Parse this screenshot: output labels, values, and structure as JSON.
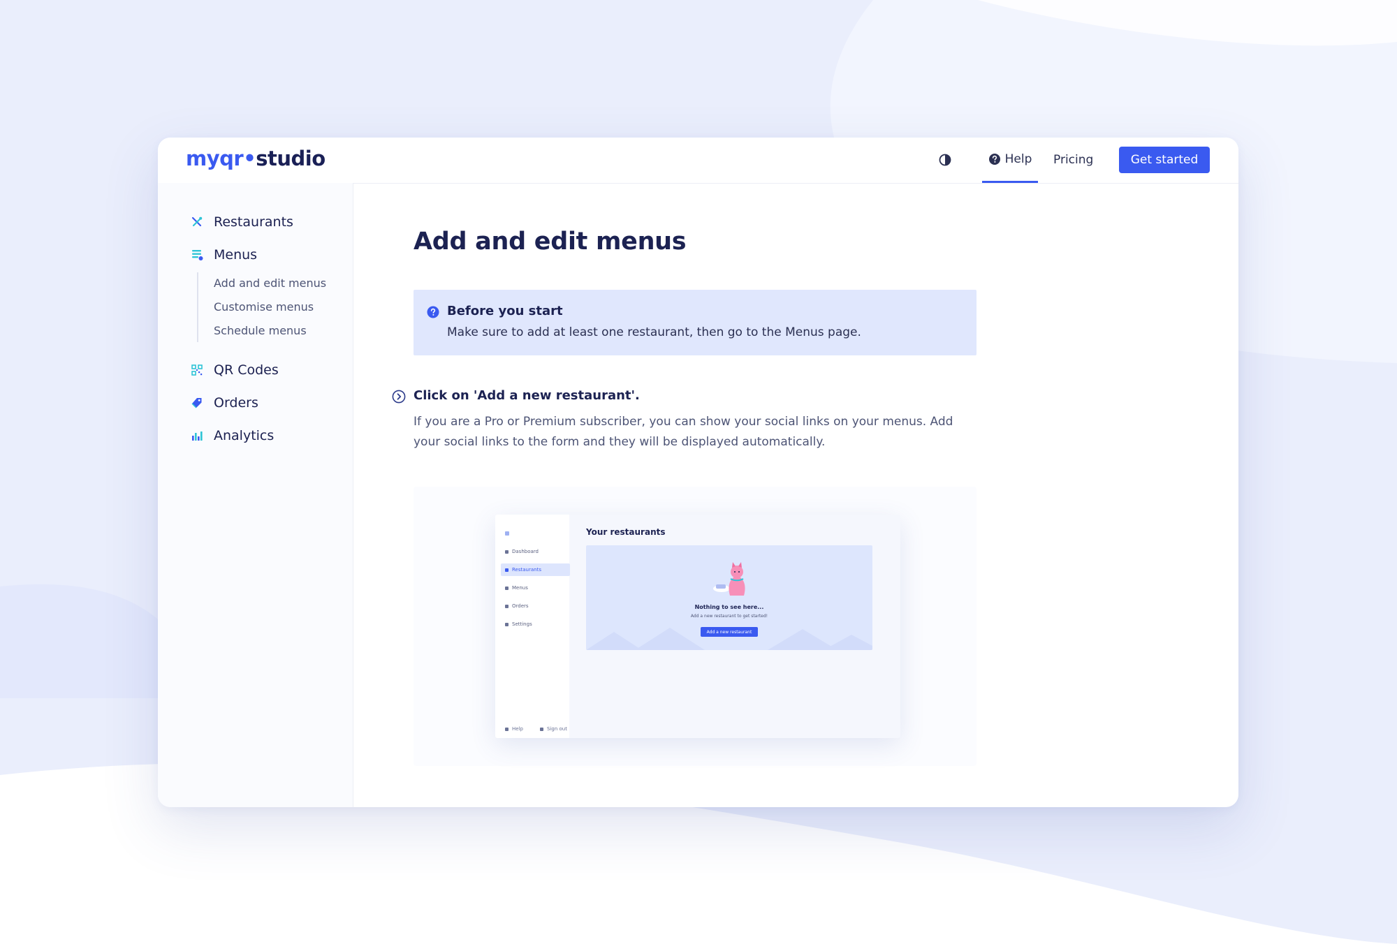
{
  "brand": {
    "name_part1": "myqr",
    "dot": "•",
    "name_part2": "studio",
    "accent_color": "#3a5af0",
    "ink_color": "#1a2056"
  },
  "header": {
    "theme_toggle_icon": "contrast-icon",
    "help_label": "Help",
    "pricing_label": "Pricing",
    "cta_label": "Get started"
  },
  "sidebar": {
    "items": [
      {
        "label": "Restaurants",
        "icon": "utensils-icon"
      },
      {
        "label": "Menus",
        "icon": "menu-list-icon"
      },
      {
        "label": "QR Codes",
        "icon": "qr-code-icon"
      },
      {
        "label": "Orders",
        "icon": "tag-icon"
      },
      {
        "label": "Analytics",
        "icon": "bar-chart-icon"
      }
    ],
    "menus_subitems": [
      "Add and edit menus",
      "Customise menus",
      "Schedule menus"
    ]
  },
  "main": {
    "title": "Add and edit menus",
    "callout": {
      "title": "Before you start",
      "body": "Make sure to add at least one restaurant, then go to the Menus page."
    },
    "step": {
      "title": "Click on 'Add a new restaurant'.",
      "body": "If you are a Pro or Premium subscriber, you can show your social links on your menus. Add your social links to the form and they will be displayed automatically."
    },
    "screenshot": {
      "sidebar_items": [
        "Dashboard",
        "Restaurants",
        "Menus",
        "Orders",
        "Settings"
      ],
      "active_item": "Restaurants",
      "footer": [
        "Help",
        "Sign out"
      ],
      "title": "Your restaurants",
      "empty_title": "Nothing to see here...",
      "empty_body": "Add a new restaurant to get started!",
      "button_label": "Add a new restaurant"
    }
  }
}
